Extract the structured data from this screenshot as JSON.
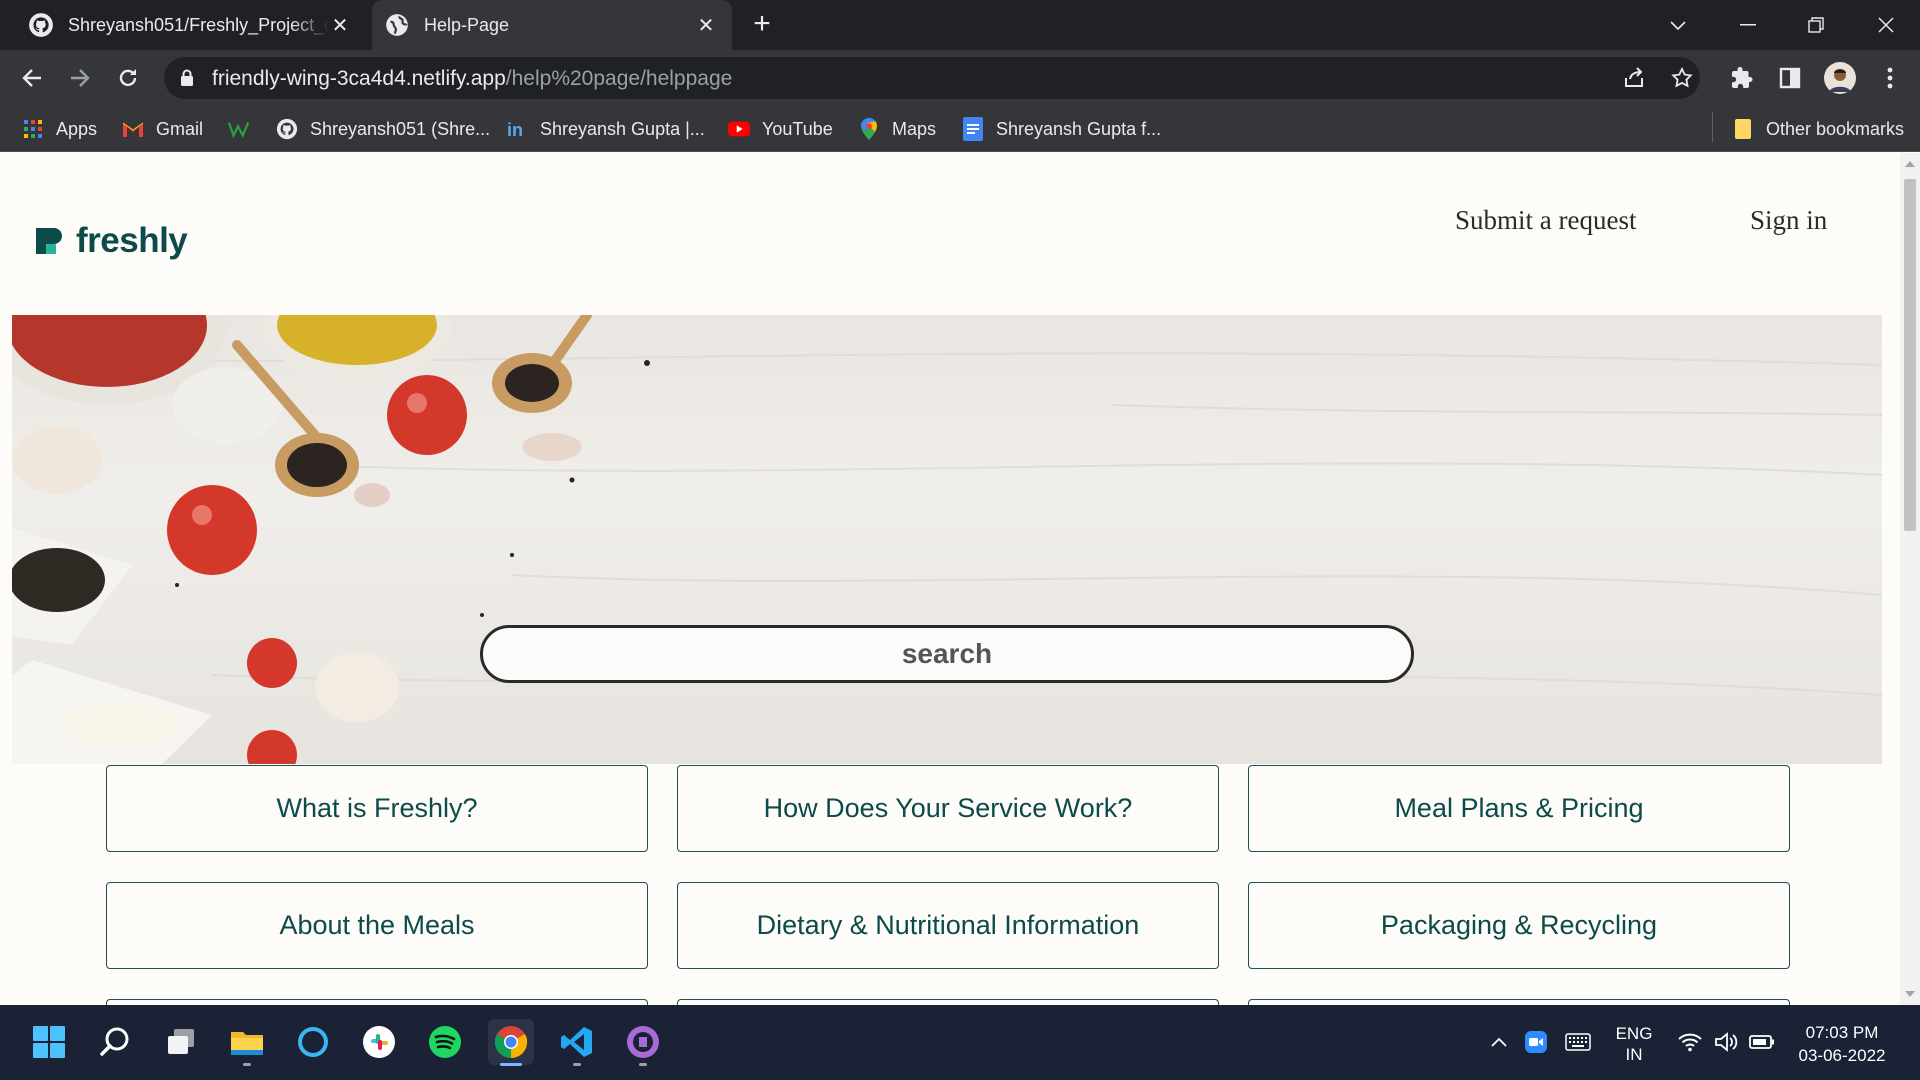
{
  "browser": {
    "tabs": [
      {
        "title": "Shreyansh051/Freshly_Project_cl",
        "active": false,
        "icon": "github-icon"
      },
      {
        "title": "Help-Page",
        "active": true,
        "icon": "globe-icon"
      }
    ],
    "url_host": "friendly-wing-3ca4d4.netlify.app",
    "url_path": "/help%20page/helppage",
    "bookmarks": [
      {
        "label": "Apps",
        "icon": "apps-grid-icon"
      },
      {
        "label": "Gmail",
        "icon": "gmail-icon"
      },
      {
        "label": "",
        "icon": "w-logo-icon"
      },
      {
        "label": "Shreyansh051 (Shre...",
        "icon": "github-icon"
      },
      {
        "label": "Shreyansh Gupta |...",
        "icon": "linkedin-icon"
      },
      {
        "label": "YouTube",
        "icon": "youtube-icon"
      },
      {
        "label": "Maps",
        "icon": "maps-icon"
      },
      {
        "label": "Shreyansh Gupta f...",
        "icon": "docs-icon"
      }
    ],
    "other_bookmarks": "Other bookmarks"
  },
  "page": {
    "brand": "freshly",
    "nav": {
      "submit": "Submit a request",
      "signin": "Sign in"
    },
    "search_placeholder": "search",
    "cards": [
      "What is Freshly?",
      "How Does Your Service Work?",
      "Meal Plans & Pricing",
      "About the Meals",
      "Dietary & Nutritional Information",
      "Packaging & Recycling"
    ]
  },
  "taskbar": {
    "lang_top": "ENG",
    "lang_bottom": "IN",
    "time": "07:03 PM",
    "date": "03-06-2022"
  },
  "colors": {
    "brand": "#0d4a4a",
    "card_border": "#1e4d52",
    "chrome_dark": "#202124",
    "chrome_mid": "#35363a",
    "taskbar": "#1b2236"
  }
}
